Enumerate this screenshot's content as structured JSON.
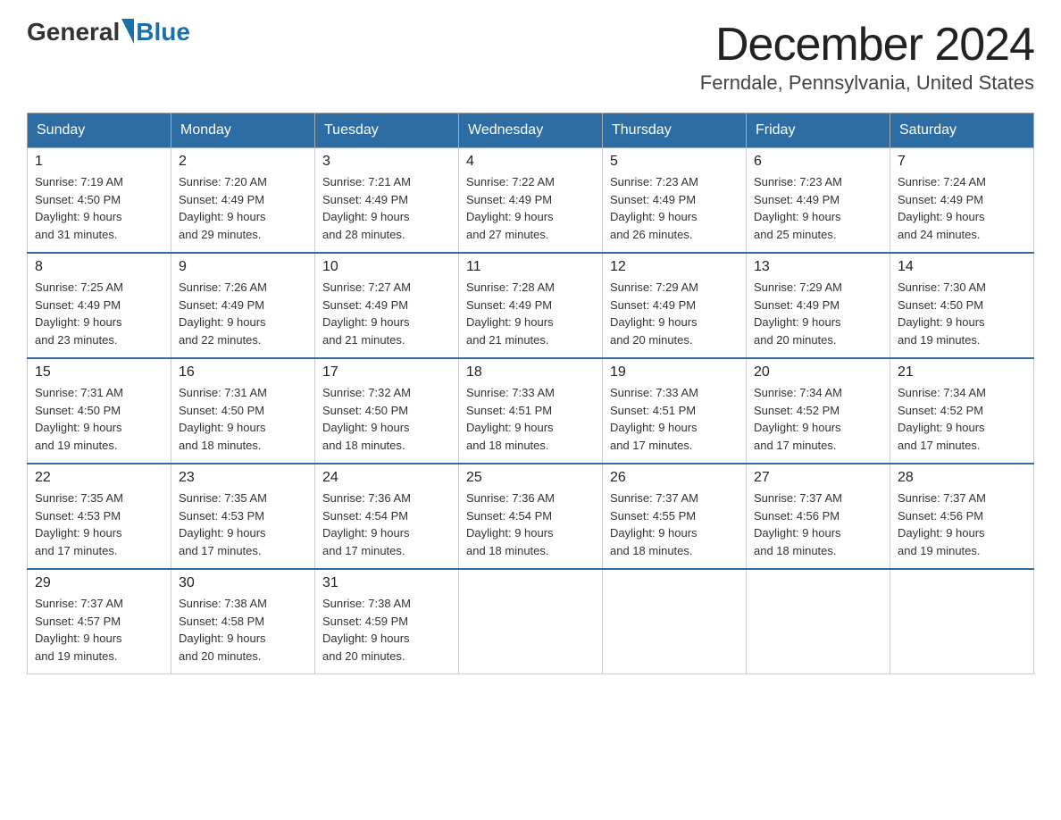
{
  "header": {
    "logo_general": "General",
    "logo_blue": "Blue",
    "month_title": "December 2024",
    "location": "Ferndale, Pennsylvania, United States"
  },
  "weekdays": [
    "Sunday",
    "Monday",
    "Tuesday",
    "Wednesday",
    "Thursday",
    "Friday",
    "Saturday"
  ],
  "weeks": [
    [
      {
        "day": "1",
        "sunrise": "7:19 AM",
        "sunset": "4:50 PM",
        "daylight": "9 hours and 31 minutes."
      },
      {
        "day": "2",
        "sunrise": "7:20 AM",
        "sunset": "4:49 PM",
        "daylight": "9 hours and 29 minutes."
      },
      {
        "day": "3",
        "sunrise": "7:21 AM",
        "sunset": "4:49 PM",
        "daylight": "9 hours and 28 minutes."
      },
      {
        "day": "4",
        "sunrise": "7:22 AM",
        "sunset": "4:49 PM",
        "daylight": "9 hours and 27 minutes."
      },
      {
        "day": "5",
        "sunrise": "7:23 AM",
        "sunset": "4:49 PM",
        "daylight": "9 hours and 26 minutes."
      },
      {
        "day": "6",
        "sunrise": "7:23 AM",
        "sunset": "4:49 PM",
        "daylight": "9 hours and 25 minutes."
      },
      {
        "day": "7",
        "sunrise": "7:24 AM",
        "sunset": "4:49 PM",
        "daylight": "9 hours and 24 minutes."
      }
    ],
    [
      {
        "day": "8",
        "sunrise": "7:25 AM",
        "sunset": "4:49 PM",
        "daylight": "9 hours and 23 minutes."
      },
      {
        "day": "9",
        "sunrise": "7:26 AM",
        "sunset": "4:49 PM",
        "daylight": "9 hours and 22 minutes."
      },
      {
        "day": "10",
        "sunrise": "7:27 AM",
        "sunset": "4:49 PM",
        "daylight": "9 hours and 21 minutes."
      },
      {
        "day": "11",
        "sunrise": "7:28 AM",
        "sunset": "4:49 PM",
        "daylight": "9 hours and 21 minutes."
      },
      {
        "day": "12",
        "sunrise": "7:29 AM",
        "sunset": "4:49 PM",
        "daylight": "9 hours and 20 minutes."
      },
      {
        "day": "13",
        "sunrise": "7:29 AM",
        "sunset": "4:49 PM",
        "daylight": "9 hours and 20 minutes."
      },
      {
        "day": "14",
        "sunrise": "7:30 AM",
        "sunset": "4:50 PM",
        "daylight": "9 hours and 19 minutes."
      }
    ],
    [
      {
        "day": "15",
        "sunrise": "7:31 AM",
        "sunset": "4:50 PM",
        "daylight": "9 hours and 19 minutes."
      },
      {
        "day": "16",
        "sunrise": "7:31 AM",
        "sunset": "4:50 PM",
        "daylight": "9 hours and 18 minutes."
      },
      {
        "day": "17",
        "sunrise": "7:32 AM",
        "sunset": "4:50 PM",
        "daylight": "9 hours and 18 minutes."
      },
      {
        "day": "18",
        "sunrise": "7:33 AM",
        "sunset": "4:51 PM",
        "daylight": "9 hours and 18 minutes."
      },
      {
        "day": "19",
        "sunrise": "7:33 AM",
        "sunset": "4:51 PM",
        "daylight": "9 hours and 17 minutes."
      },
      {
        "day": "20",
        "sunrise": "7:34 AM",
        "sunset": "4:52 PM",
        "daylight": "9 hours and 17 minutes."
      },
      {
        "day": "21",
        "sunrise": "7:34 AM",
        "sunset": "4:52 PM",
        "daylight": "9 hours and 17 minutes."
      }
    ],
    [
      {
        "day": "22",
        "sunrise": "7:35 AM",
        "sunset": "4:53 PM",
        "daylight": "9 hours and 17 minutes."
      },
      {
        "day": "23",
        "sunrise": "7:35 AM",
        "sunset": "4:53 PM",
        "daylight": "9 hours and 17 minutes."
      },
      {
        "day": "24",
        "sunrise": "7:36 AM",
        "sunset": "4:54 PM",
        "daylight": "9 hours and 17 minutes."
      },
      {
        "day": "25",
        "sunrise": "7:36 AM",
        "sunset": "4:54 PM",
        "daylight": "9 hours and 18 minutes."
      },
      {
        "day": "26",
        "sunrise": "7:37 AM",
        "sunset": "4:55 PM",
        "daylight": "9 hours and 18 minutes."
      },
      {
        "day": "27",
        "sunrise": "7:37 AM",
        "sunset": "4:56 PM",
        "daylight": "9 hours and 18 minutes."
      },
      {
        "day": "28",
        "sunrise": "7:37 AM",
        "sunset": "4:56 PM",
        "daylight": "9 hours and 19 minutes."
      }
    ],
    [
      {
        "day": "29",
        "sunrise": "7:37 AM",
        "sunset": "4:57 PM",
        "daylight": "9 hours and 19 minutes."
      },
      {
        "day": "30",
        "sunrise": "7:38 AM",
        "sunset": "4:58 PM",
        "daylight": "9 hours and 20 minutes."
      },
      {
        "day": "31",
        "sunrise": "7:38 AM",
        "sunset": "4:59 PM",
        "daylight": "9 hours and 20 minutes."
      },
      null,
      null,
      null,
      null
    ]
  ],
  "labels": {
    "sunrise_prefix": "Sunrise: ",
    "sunset_prefix": "Sunset: ",
    "daylight_prefix": "Daylight: "
  }
}
